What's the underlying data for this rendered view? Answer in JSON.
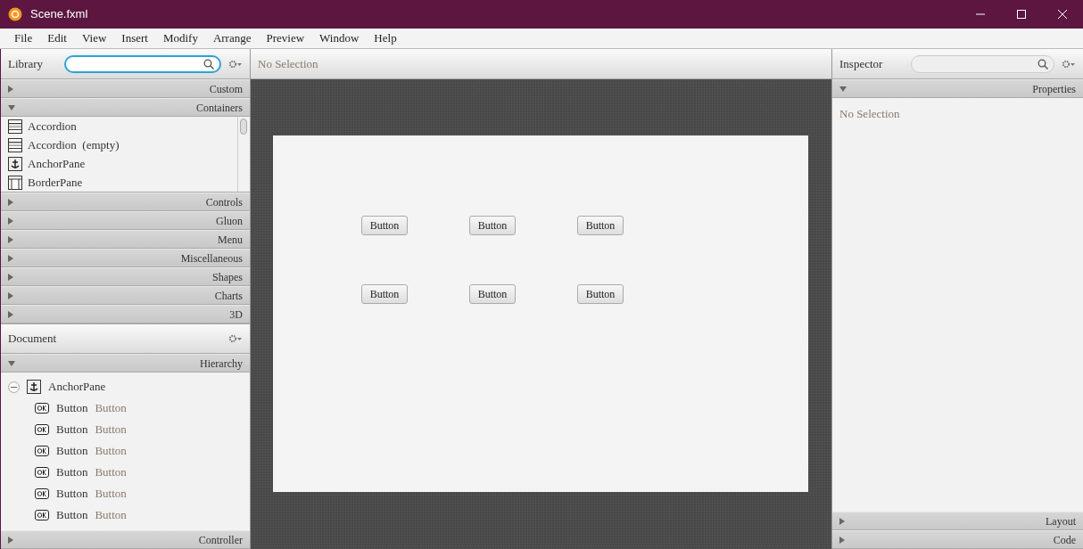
{
  "window": {
    "title": "Scene.fxml"
  },
  "menu": [
    "File",
    "Edit",
    "View",
    "Insert",
    "Modify",
    "Arrange",
    "Preview",
    "Window",
    "Help"
  ],
  "library": {
    "title": "Library",
    "sections": [
      {
        "label": "Custom",
        "expanded": false
      },
      {
        "label": "Containers",
        "expanded": true,
        "items": [
          {
            "label": "Accordion",
            "kind": "accordion"
          },
          {
            "label": "Accordion  (empty)",
            "kind": "accordion"
          },
          {
            "label": "AnchorPane",
            "kind": "anchor"
          },
          {
            "label": "BorderPane",
            "kind": "border"
          }
        ]
      },
      {
        "label": "Controls",
        "expanded": false
      },
      {
        "label": "Gluon",
        "expanded": false
      },
      {
        "label": "Menu",
        "expanded": false
      },
      {
        "label": "Miscellaneous",
        "expanded": false
      },
      {
        "label": "Shapes",
        "expanded": false
      },
      {
        "label": "Charts",
        "expanded": false
      },
      {
        "label": "3D",
        "expanded": false
      }
    ]
  },
  "document": {
    "title": "Document",
    "hierarchy": {
      "label": "Hierarchy",
      "expanded": true,
      "tree": [
        {
          "label": "AnchorPane",
          "kind": "anchor",
          "expanded": true,
          "children": [
            {
              "label": "Button",
              "text": "Button",
              "kind": "button"
            },
            {
              "label": "Button",
              "text": "Button",
              "kind": "button"
            },
            {
              "label": "Button",
              "text": "Button",
              "kind": "button"
            },
            {
              "label": "Button",
              "text": "Button",
              "kind": "button"
            },
            {
              "label": "Button",
              "text": "Button",
              "kind": "button"
            },
            {
              "label": "Button",
              "text": "Button",
              "kind": "button"
            }
          ]
        }
      ]
    },
    "controller": {
      "label": "Controller",
      "expanded": false
    }
  },
  "editor": {
    "status": "No Selection",
    "canvas_buttons": [
      {
        "label": "Button"
      },
      {
        "label": "Button"
      },
      {
        "label": "Button"
      },
      {
        "label": "Button"
      },
      {
        "label": "Button"
      },
      {
        "label": "Button"
      }
    ]
  },
  "inspector": {
    "title": "Inspector",
    "sections": [
      {
        "label": "Properties",
        "expanded": true,
        "body": "No Selection"
      },
      {
        "label": "Layout",
        "expanded": false
      },
      {
        "label": "Code",
        "expanded": false
      }
    ]
  }
}
